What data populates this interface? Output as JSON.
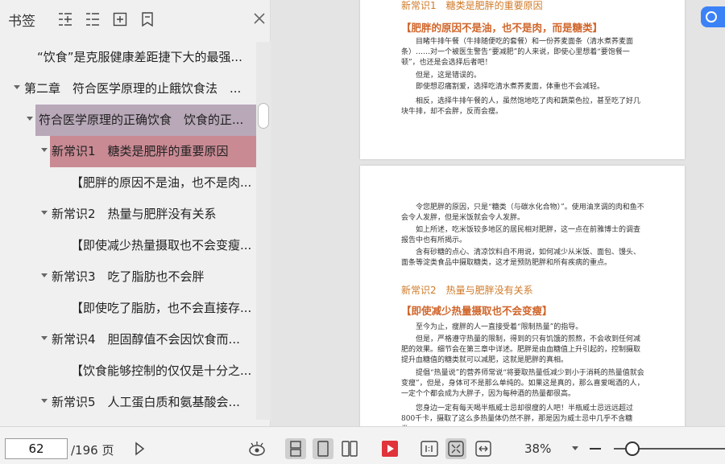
{
  "sidebar": {
    "title": "书签",
    "items": [
      {
        "label": "“饮食”是克服健康差距捷下大的最强..."
      },
      {
        "label": "第二章　符合医学原理的止餓饮食法　..."
      },
      {
        "label": "符合医学原理的正确饮食　饮食的正..."
      },
      {
        "label": "新常识1　糖类是肥胖的重要原因"
      },
      {
        "label": "【肥胖的原因不是油，也不是肉..."
      },
      {
        "label": "新常识2　热量与肥胖没有关系"
      },
      {
        "label": "【即使减少热量摄取也不会变瘦..."
      },
      {
        "label": "新常识3　吃了脂肪也不会胖"
      },
      {
        "label": "【即使吃了脂肪，也不会直接存..."
      },
      {
        "label": "新常识4　胆固醇值不会因饮食而..."
      },
      {
        "label": "【饮食能够控制的仅仅是十分之..."
      },
      {
        "label": "新常识5　人工蛋白质和氨基酸会..."
      }
    ]
  },
  "document": {
    "page1": {
      "heading": "新常识1　糖类是肥胖的重要原因",
      "subheading": "【肥胖的原因不是油，也不是肉，而是糖类】",
      "paragraphs": [
        "目睹牛排午餐（牛排随便吃的套餐）和一份荞麦面条（清水煮荞麦面条）……对一个被医生警告“要减肥”的人来说，即使心里想着“要饱餐一顿”，也还是会选择后者吧！",
        "但是，这是错误的。",
        "即使想忍痛割爱，选择吃清水煮荞麦面，体重也不会减轻。",
        "相反，选择牛排午餐的人，虽然饱地吃了肉和蔬菜色拉，甚至吃了好几块牛排，却不会胖，反而会瘦。"
      ]
    },
    "page2": {
      "paragraphs_top": [
        "令您肥胖的原因，只是“糖类（与碳水化合物）”。使用油烹调的肉和鱼不会令人发胖，但是米饭就会令人发胖。",
        "如上所述，吃米饭较多地区的居民相对肥胖，这一点在前雅博士的调查报告中也有所揭示。",
        "含有砂糖的点心、清凉饮料自不用说，如何减少从米饭、面包、馒头、面条等淀类食品中摄取糖类，这才是预防肥胖和所有疾病的重点。"
      ],
      "heading": "新常识2　热量与肥胖没有关系",
      "subheading": "【即使减少热量摄取也不会变瘦】",
      "paragraphs_bottom": [
        "至今为止，瘦胖的人一直接受着“限制热量”的指导。",
        "但是，严格遵守热量的限制，得到的只有饥饿的煎熬，不会收到任何减肥的效果。细节会在第三章中详述。肥胖是由血糖值上升引起的，控制摄取提升血糖值的糖类就可以减肥，这就是肥胖的真相。",
        "提倡“热量说”的营养师常说“将要取热量低减少到小于消耗的热量值就会变瘦”，但是，身体可不是那么单纯的。如果这是真的，那么喜爱喝酒的人，一定个个都会成为大胖子，因为每种酒的热量都很高。",
        "您身边一定有每天喝半瓶威士忌却很瘦的人吧！半瓶威士忌远远超过800千卡，摄取了这么多热量体仍然不胖，那是因为威士忌中几乎不含糖类……"
      ]
    }
  },
  "toolbar": {
    "page_input": "62",
    "page_total": "/196 页",
    "zoom_level": "38%",
    "zoom_fraction": 0.12
  },
  "colors": {
    "highlight_chapter": "#b8a8b8",
    "highlight_section": "#c98a94",
    "accent_orange": "#d07a28",
    "play_red": "#e0333a"
  }
}
